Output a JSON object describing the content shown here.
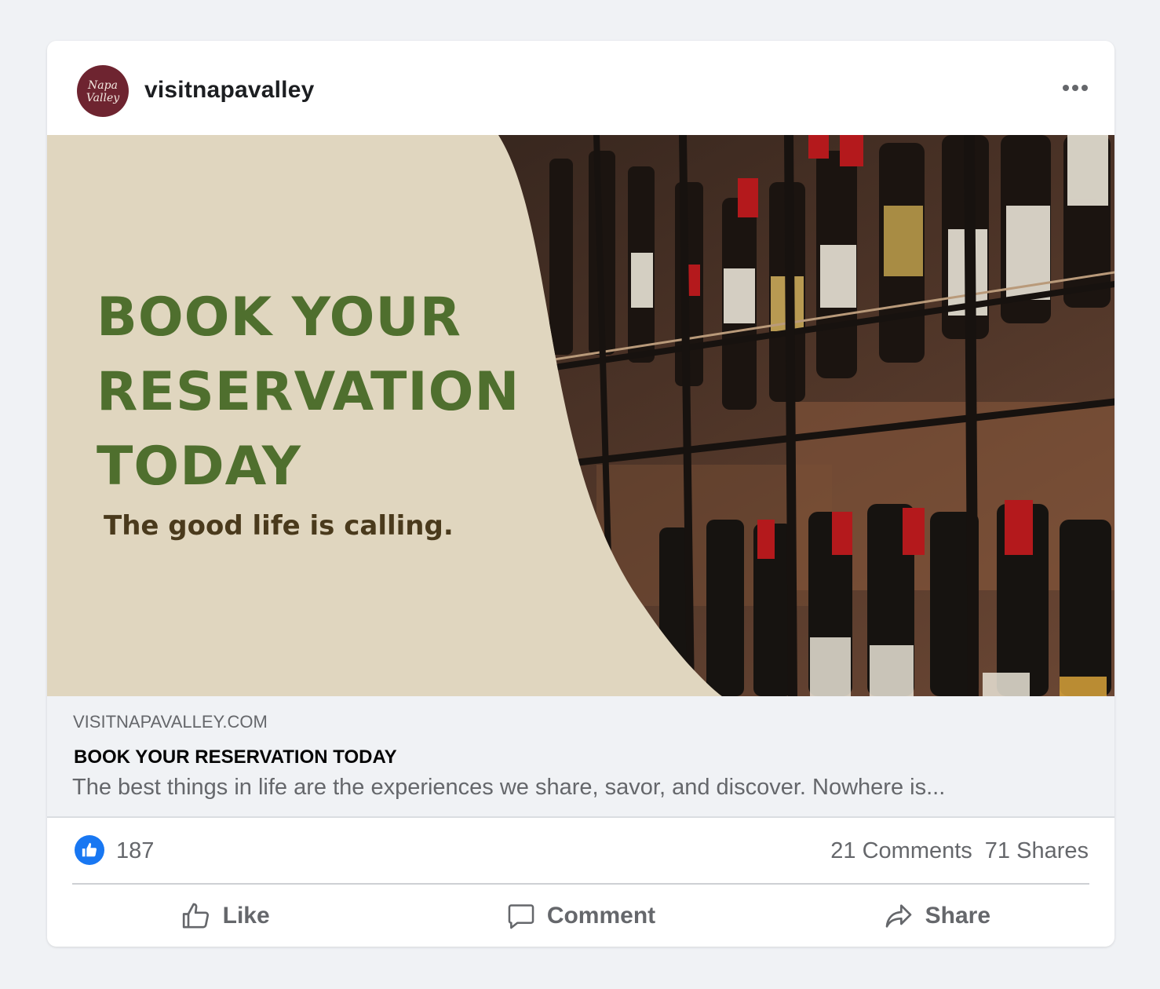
{
  "post": {
    "account": {
      "username": "visitnapavalley",
      "avatar_text": "Napa Valley"
    },
    "menu_icon": "more-horizontal-icon",
    "image": {
      "headline": "BOOK YOUR\nRESERVATION\nTODAY",
      "tagline": "The good life is calling.",
      "colors": {
        "background": "#e0d6bf",
        "headline": "#4f6f2e",
        "tagline": "#4a3a1c"
      }
    },
    "link_preview": {
      "domain": "VISITNAPAVALLEY.COM",
      "title": "BOOK YOUR RESERVATION TODAY",
      "description": "The best things in life are the experiences we share, savor, and discover. Nowhere is..."
    },
    "stats": {
      "likes": "187",
      "comments": "21 Comments",
      "shares": "71 Shares"
    },
    "actions": [
      {
        "label": "Like",
        "icon": "thumbs-up-icon"
      },
      {
        "label": "Comment",
        "icon": "comment-bubble-icon"
      },
      {
        "label": "Share",
        "icon": "share-arrow-icon"
      }
    ],
    "accent_color": "#1877f2"
  }
}
